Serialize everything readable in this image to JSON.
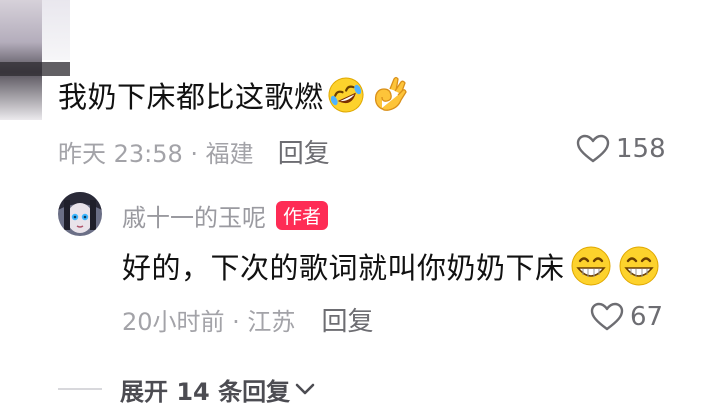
{
  "comment": {
    "text": "我奶下床都比这歌燃",
    "emojis": [
      "rolling-laughing-icon",
      "ok-hand-icon"
    ],
    "meta": "昨天 23:58 · 福建",
    "reply_label": "回复",
    "likes": "158"
  },
  "reply": {
    "author": "戚十一的玉呢",
    "badge": "作者",
    "text": "好的，下次的歌词就叫你奶奶下床",
    "emojis": [
      "grin-icon",
      "grin-icon"
    ],
    "meta": "20小时前 · 江苏",
    "reply_label": "回复",
    "likes": "67"
  },
  "expand": {
    "label": "展开 14 条回复"
  },
  "colors": {
    "badge": "#fe2c55",
    "meta_gray": "#a3a3a8",
    "emoji_yellow": "#fdd22c"
  }
}
